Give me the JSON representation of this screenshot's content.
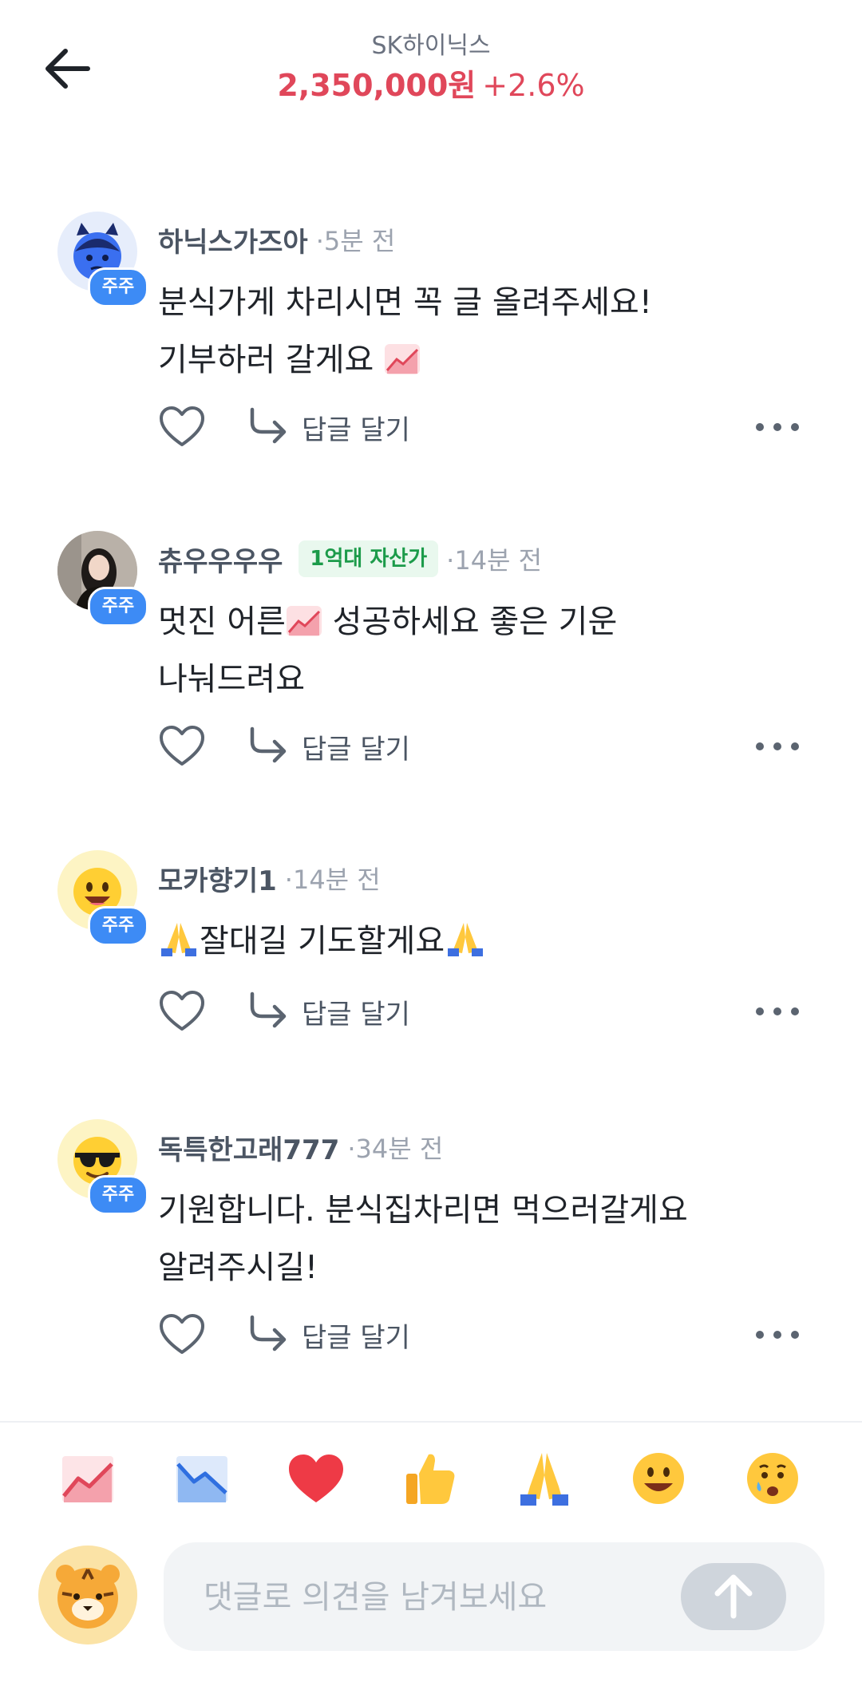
{
  "header": {
    "stock_name": "SK하이닉스",
    "price": "2,350,000원",
    "change": "+2.6%"
  },
  "comments": [
    {
      "author": "하닉스가즈아",
      "time": "5분 전",
      "badge": "주주",
      "lines": [
        "분식가게 차리시면 꼭 글 올려주세요!",
        "기부하러 갈게요"
      ],
      "reply_label": "답글 달기"
    },
    {
      "author": "츄우우우우",
      "asset_badge": "1억대 자산가",
      "time": "14분 전",
      "badge": "주주",
      "lines": [
        "멋진 어른",
        " 성공하세요 좋은 기운",
        "나눠드려요"
      ],
      "reply_label": "답글 달기"
    },
    {
      "author": "모카향기1",
      "time": "14분 전",
      "badge": "주주",
      "lines": [
        "잘대길  기도할게요"
      ],
      "reply_label": "답글 달기"
    },
    {
      "author": "독특한고래777",
      "time": "34분 전",
      "badge": "주주",
      "lines": [
        "기원합니다. 분식집차리면 먹으러갈게요",
        "알려주시길!"
      ],
      "reply_label": "답글 달기"
    }
  ],
  "reactions": [
    "chart-up-icon",
    "chart-down-icon",
    "heart-icon",
    "thumbs-up-icon",
    "pray-icon",
    "smile-icon",
    "crying-icon"
  ],
  "composer": {
    "placeholder": "댓글로 의견을 남겨보세요"
  },
  "colors": {
    "price_up": "#e0475a",
    "badge_blue": "#3d8bf5",
    "asset_green": "#1c9b4a"
  }
}
